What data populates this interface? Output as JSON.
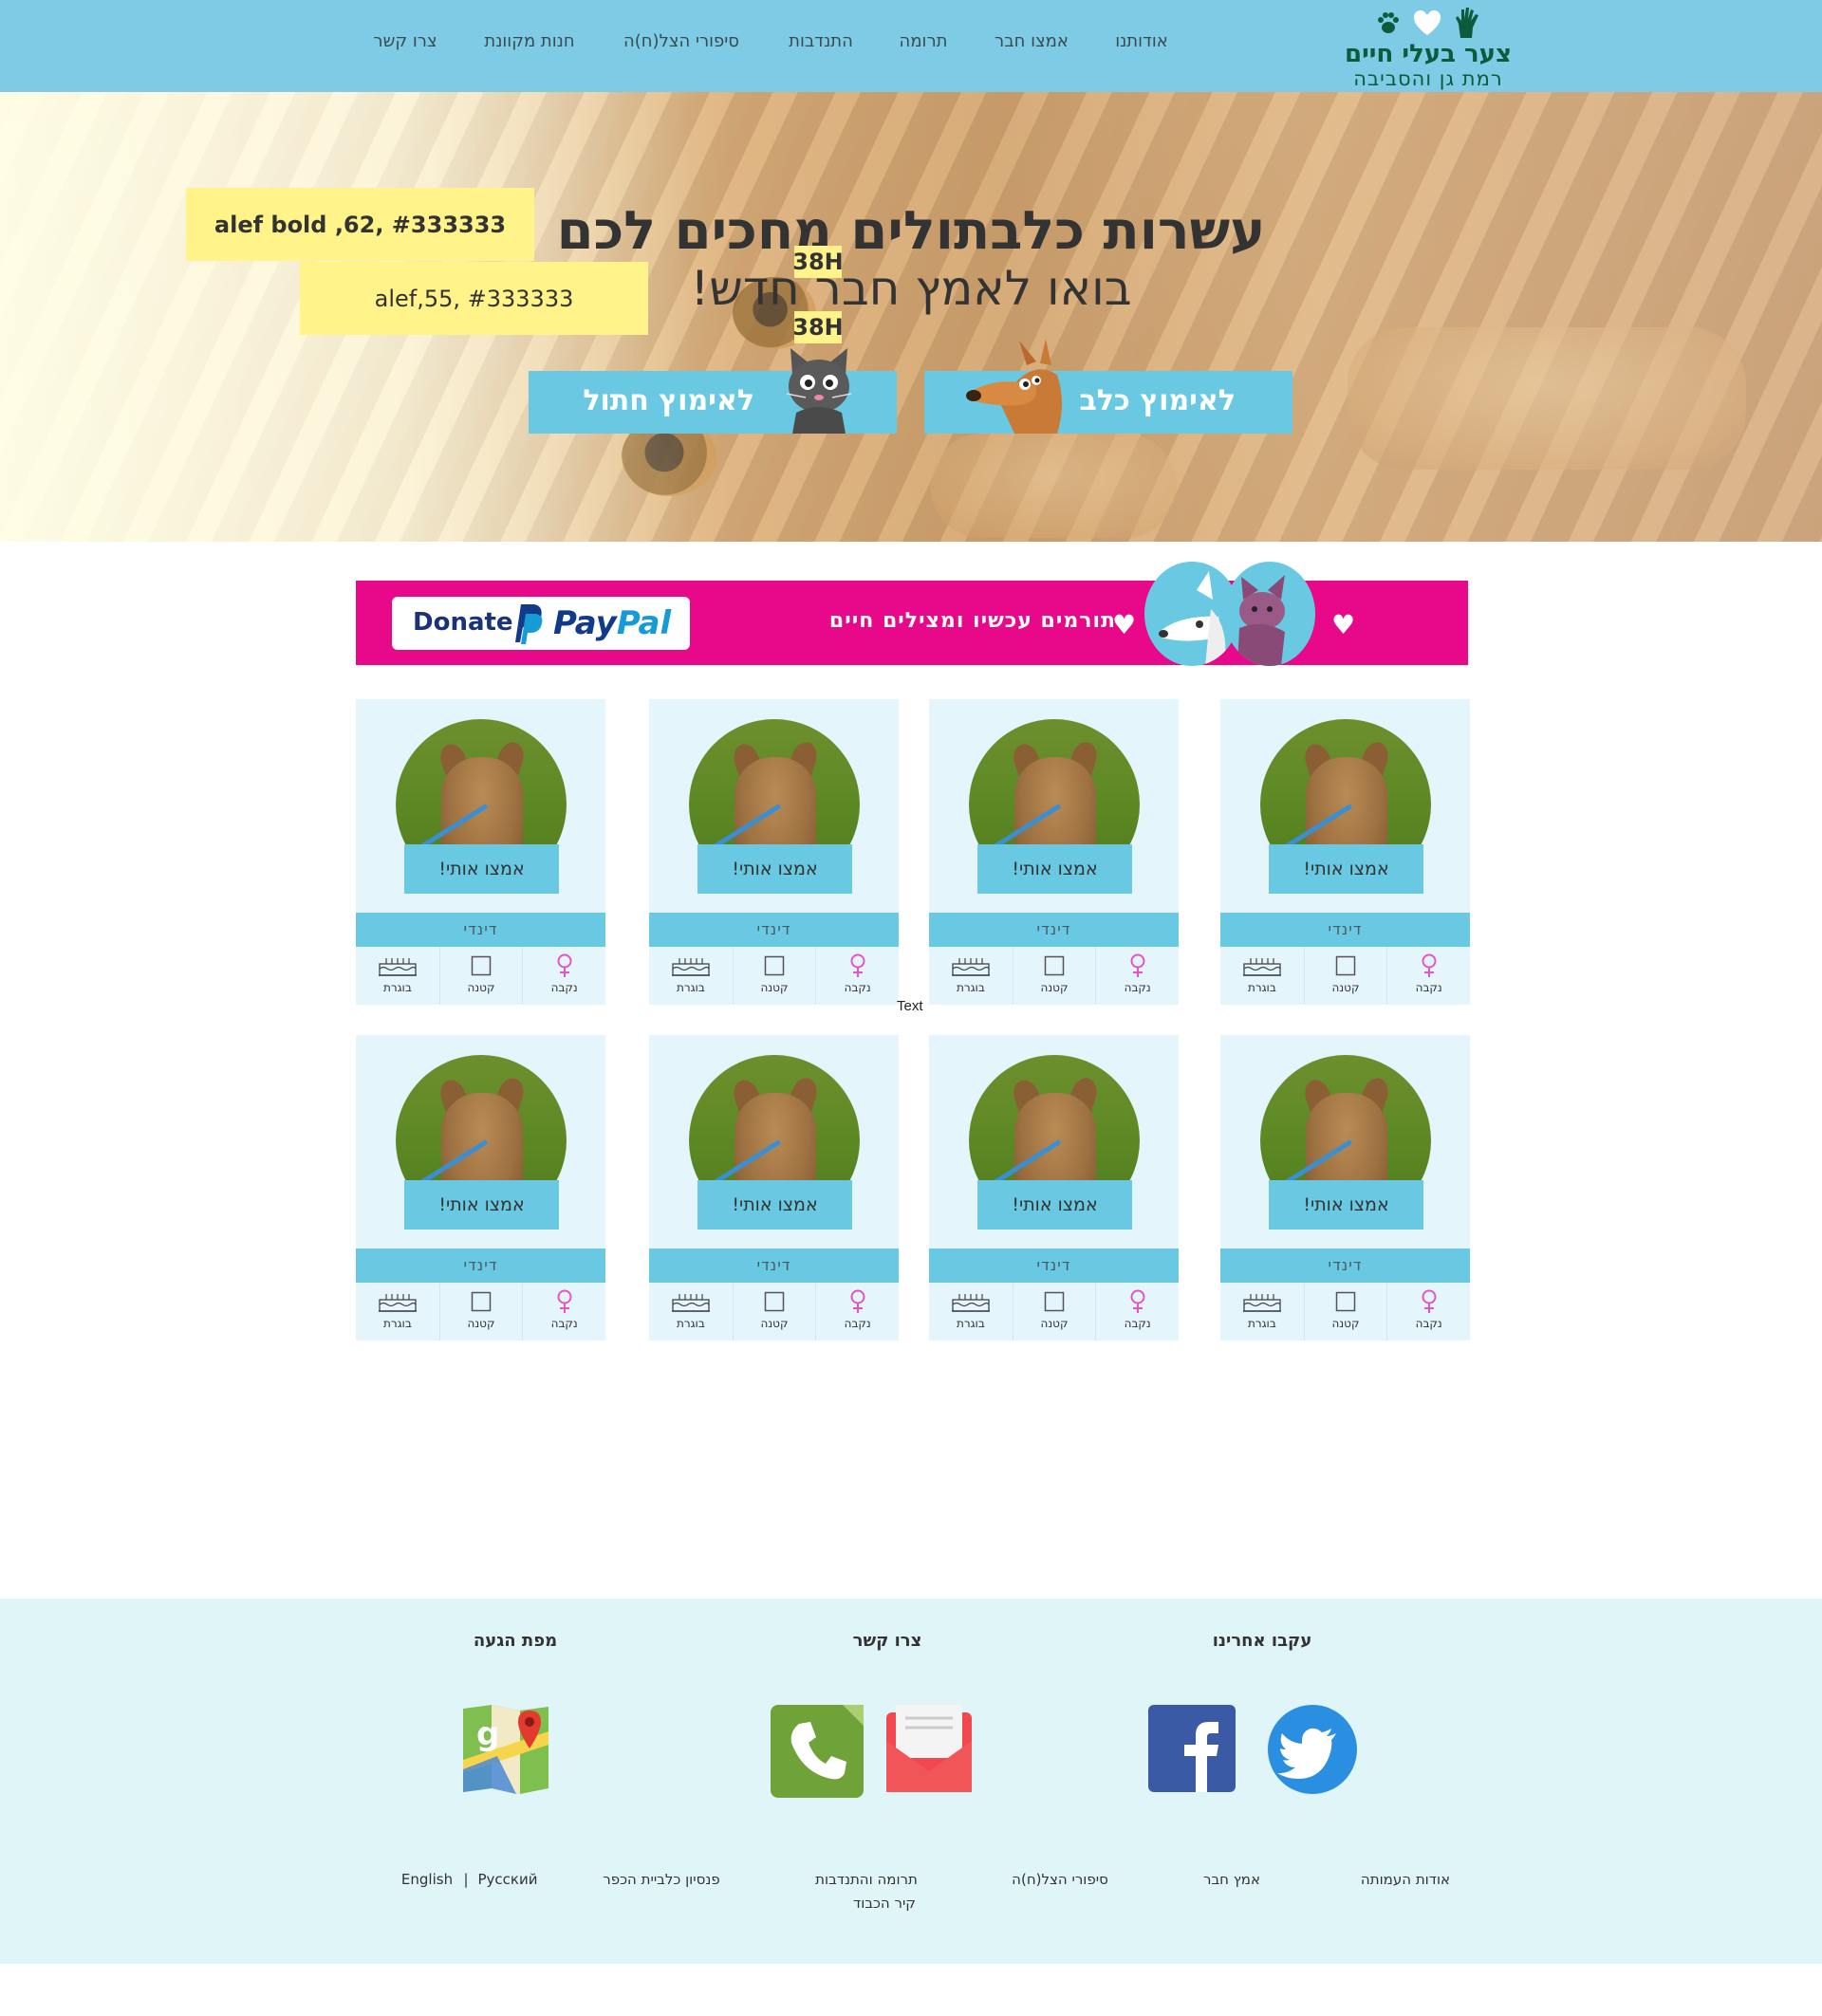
{
  "header": {
    "logo_title": "צער בעלי חיים",
    "logo_subtitle": "רמת גן והסביבה",
    "nav": [
      "אודותנו",
      "אמצו חבר",
      "תרומה",
      "התנדבות",
      "סיפורי הצל(ח)ה",
      "חנות מקוונת",
      "צרו קשר"
    ]
  },
  "hero": {
    "title": "עשרות כלבתולים מחכים לכם",
    "subtitle": "בואו לאמץ חבר חדש!",
    "note_title": "alef bold ,62, #333333",
    "note_subtitle": "alef,55, #333333",
    "spacing_tag_1": "38H",
    "spacing_tag_2": "38H",
    "adopt_dog_label": "לאימוץ כלב",
    "adopt_cat_label": "לאימוץ חתול"
  },
  "donate": {
    "donate_label": "Donate",
    "paypal_pay": "Pay",
    "paypal_pal": "Pal",
    "text": "תורמים עכשיו ומצילים חיים"
  },
  "cards": [
    {
      "adopt": "אמצו אותי!",
      "name": "דינדי",
      "gender": "נקבה",
      "size": "קטנה",
      "age": "בוגרת"
    },
    {
      "adopt": "אמצו אותי!",
      "name": "דינדי",
      "gender": "נקבה",
      "size": "קטנה",
      "age": "בוגרת"
    },
    {
      "adopt": "אמצו אותי!",
      "name": "דינדי",
      "gender": "נקבה",
      "size": "קטנה",
      "age": "בוגרת"
    },
    {
      "adopt": "אמצו אותי!",
      "name": "דינדי",
      "gender": "נקבה",
      "size": "קטנה",
      "age": "בוגרת"
    },
    {
      "adopt": "אמצו אותי!",
      "name": "דינדי",
      "gender": "נקבה",
      "size": "קטנה",
      "age": "בוגרת"
    },
    {
      "adopt": "אמצו אותי!",
      "name": "דינדי",
      "gender": "נקבה",
      "size": "קטנה",
      "age": "בוגרת"
    },
    {
      "adopt": "אמצו אותי!",
      "name": "דינדי",
      "gender": "נקבה",
      "size": "קטנה",
      "age": "בוגרת"
    },
    {
      "adopt": "אמצו אותי!",
      "name": "דינדי",
      "gender": "נקבה",
      "size": "קטנה",
      "age": "בוגרת"
    }
  ],
  "stray_text": "Text",
  "footer": {
    "follow_heading": "עקבו אחרינו",
    "contact_heading": "צרו קשר",
    "map_heading": "מפת הגעה",
    "links": {
      "about_org": "אודות העמותה",
      "adopt_friend": "אמץ חבר",
      "success_stories": "סיפורי הצל(ח)ה",
      "donation_volunteer": "תרומה והתנדבות",
      "honor_wall": "קיר הכבוד",
      "kennel": "פנסיון כלביית הכפר",
      "russian": "Русский",
      "separator": "|",
      "english": "English"
    }
  },
  "icons": {
    "logo": [
      "hand-icon",
      "heart-icon",
      "paw-icon"
    ],
    "gender": "female-symbol-icon",
    "size": "square-icon",
    "age": "birthday-cake-icon",
    "social": [
      "twitter-icon",
      "facebook-icon"
    ],
    "contact": [
      "email-icon",
      "phone-icon"
    ],
    "map": "google-maps-icon"
  },
  "colors": {
    "header_bg": "#7ecbe6",
    "accent_blue": "#6ac9e2",
    "card_bg": "#e4f5fc",
    "donate_pink": "#e8088a",
    "logo_green": "#0e5a3c",
    "footer_bg": "#e0f5f7",
    "note_yellow": "#fff38a",
    "text": "#333333"
  }
}
